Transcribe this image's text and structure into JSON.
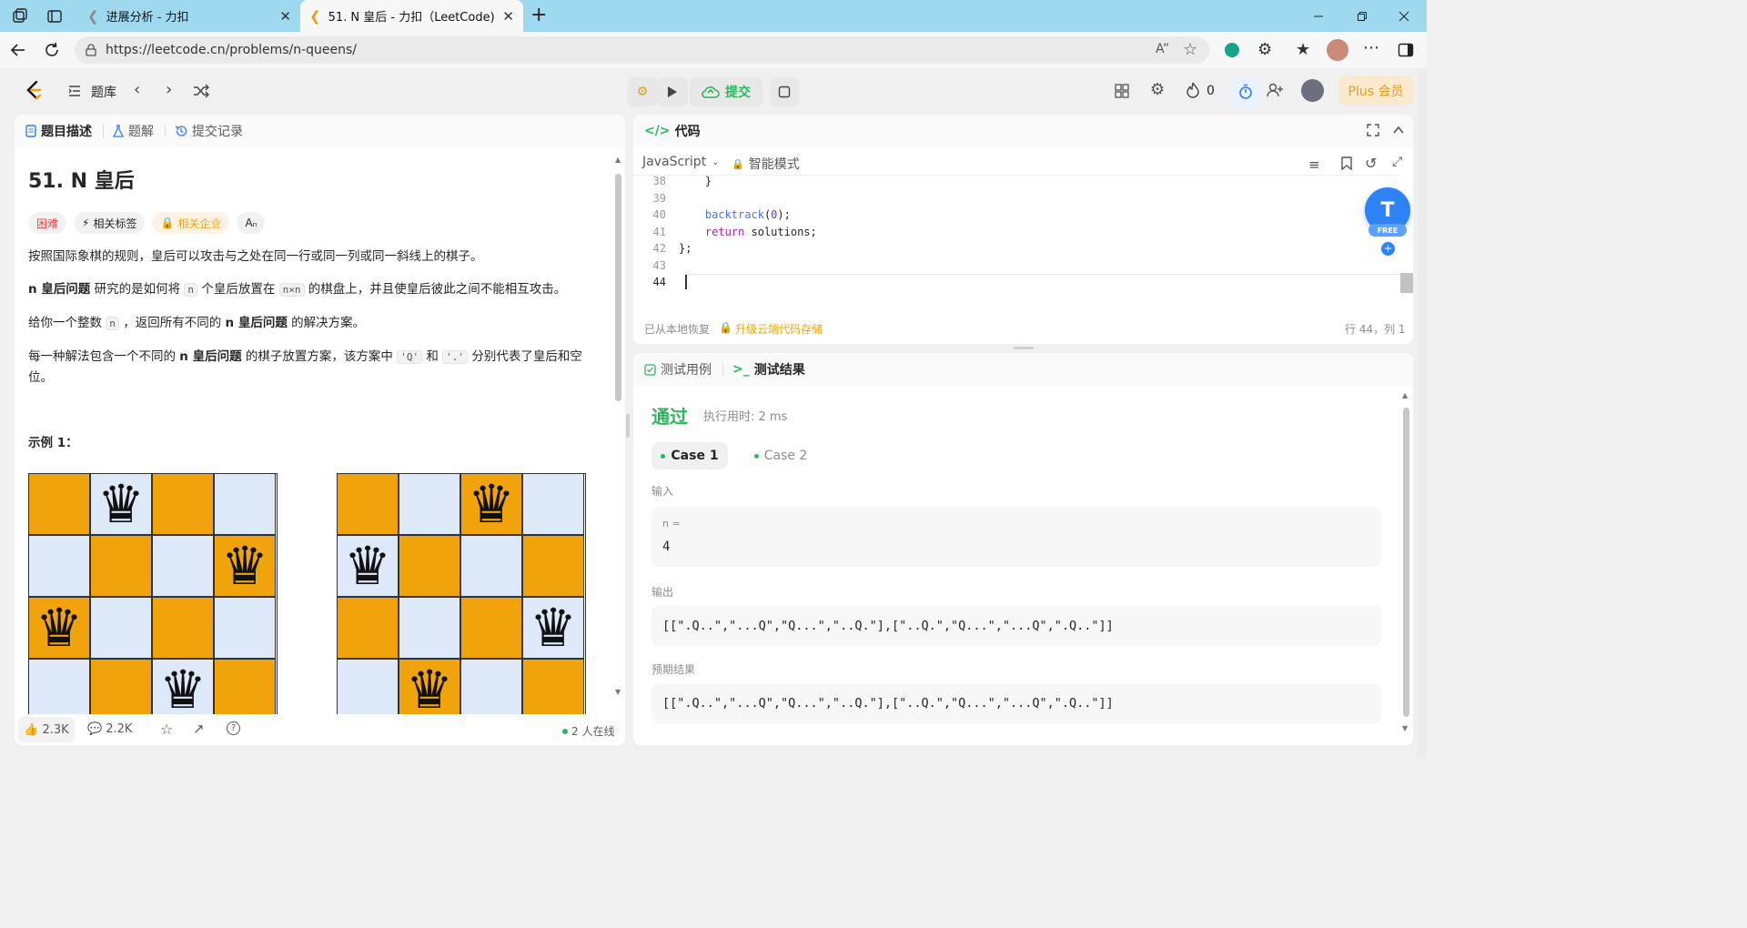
{
  "browser": {
    "tabs": [
      {
        "title": "进展分析 - 力扣"
      },
      {
        "title": "51. N 皇后 - 力扣（LeetCode)"
      }
    ],
    "url": "https://leetcode.cn/problems/n-queens/"
  },
  "topnav": {
    "problem_bank": "题库",
    "submit": "提交",
    "streak_count": "0",
    "plus": "Plus 会员"
  },
  "left_panel": {
    "tabs": [
      "题目描述",
      "题解",
      "提交记录"
    ],
    "title": "51. N 皇后",
    "tags": {
      "difficulty": "困难",
      "related_tags": "相关标签",
      "companies": "相关企业"
    },
    "para1": "按照国际象棋的规则，皇后可以攻击与之处在同一行或同一列或同一斜线上的棋子。",
    "para2": {
      "b1": "n 皇后问题",
      "t1": " 研究的是如何将 ",
      "c1": "n",
      "t2": " 个皇后放置在 ",
      "c2": "n×n",
      "t3": " 的棋盘上，并且使皇后彼此之间不能相互攻击。"
    },
    "para3": {
      "t1": "给你一个整数 ",
      "c1": "n",
      "t2": " ，返回所有不同的 ",
      "b1": "n 皇后问题",
      "t3": " 的解决方案。"
    },
    "para4": {
      "t1": "每一种解法包含一个不同的 ",
      "b1": "n 皇后问题",
      "t2": " 的棋子放置方案，该方案中 ",
      "c1": "'Q'",
      "t3": " 和 ",
      "c2": "'.'",
      "t4": " 分别代表了皇后和空位。"
    },
    "example_title": "示例 1：",
    "board1_queens": [
      1,
      3,
      0,
      2
    ],
    "board2_queens": [
      2,
      0,
      3,
      1
    ],
    "footer": {
      "likes": "2.3K",
      "comments": "2.2K",
      "online": "2 人在线"
    }
  },
  "editor": {
    "title": "代码",
    "language": "JavaScript",
    "mode": "智能模式",
    "lines": [
      {
        "n": "38",
        "code": "    }"
      },
      {
        "n": "39",
        "code": ""
      },
      {
        "n": "40",
        "code": "    backtrack(0);"
      },
      {
        "n": "41",
        "code": "    return solutions;"
      },
      {
        "n": "42",
        "code": "};"
      },
      {
        "n": "43",
        "code": ""
      },
      {
        "n": "44",
        "code": ""
      }
    ],
    "restored": "已从本地恢复",
    "upgrade": "升级云端代码存储",
    "position": "行 44，列 1",
    "ext_badge": "FREE"
  },
  "results": {
    "tabs": [
      "测试用例",
      "测试结果"
    ],
    "status": "通过",
    "runtime": "执行用时: 2 ms",
    "cases": [
      "Case 1",
      "Case 2"
    ],
    "input_label": "输入",
    "input_name": "n =",
    "input_value": "4",
    "output_label": "输出",
    "output_value": "[[\".Q..\",\"...Q\",\"Q...\",\"..Q.\"],[\"..Q.\",\"Q...\",\"...Q\",\".Q..\"]]",
    "expected_label": "预期结果",
    "expected_value": "[[\".Q..\",\"...Q\",\"Q...\",\"..Q.\"],[\"..Q.\",\"Q...\",\"...Q\",\".Q..\"]]"
  },
  "colors": {
    "accent_green": "#2db55d",
    "board_orange": "#f0a30a",
    "board_light": "#dde8f8",
    "plus_text": "#e59b24"
  }
}
